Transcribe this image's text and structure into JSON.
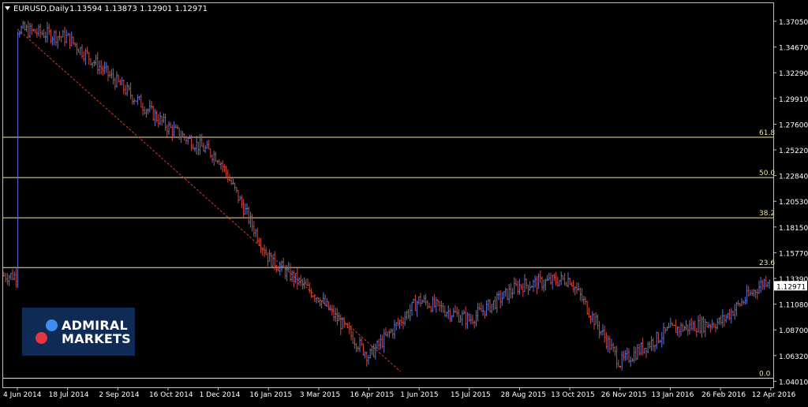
{
  "header": {
    "symbol": "EURUSD,Daily",
    "ohlc": "1.13594 1.13873 1.12901 1.12971"
  },
  "logo": {
    "line1": "ADMIRAL",
    "line2": "MARKETS"
  },
  "colors": {
    "background": "#000000",
    "frame": "#c0c0c0",
    "bull": "#5b78d8",
    "bear": "#d24a3a",
    "fib": "#f2e6a0",
    "trend": "#d23a2a",
    "axis_text": "#ffffff"
  },
  "chart_data": {
    "type": "ohlc",
    "title": "EURUSD,Daily",
    "y_ticks": [
      "1.37050",
      "1.34670",
      "1.32290",
      "1.29910",
      "1.27600",
      "1.25220",
      "1.22840",
      "1.20530",
      "1.18150",
      "1.15770",
      "1.13390",
      "1.11080",
      "1.08700",
      "1.06320",
      "1.04010"
    ],
    "ylim": [
      1.0401,
      1.3824
    ],
    "x_ticks": [
      "4 Jun 2014",
      "18 Jul 2014",
      "2 Sep 2014",
      "16 Oct 2014",
      "1 Dec 2014",
      "16 Jan 2015",
      "3 Mar 2015",
      "16 Apr 2015",
      "1 Jun 2015",
      "15 Jul 2015",
      "28 Aug 2015",
      "13 Oct 2015",
      "26 Nov 2015",
      "13 Jan 2016",
      "26 Feb 2016",
      "12 Apr 2016"
    ],
    "current_price": "1.12971",
    "fibonacci": {
      "levels": [
        {
          "label": "61.8",
          "price": 1.264
        },
        {
          "label": "50.0",
          "price": 1.2276
        },
        {
          "label": "38.2",
          "price": 1.1912
        },
        {
          "label": "23.6",
          "price": 1.1462
        },
        {
          "label": "0.0",
          "price": 1.0462
        }
      ]
    },
    "trendline": {
      "from": {
        "x": "4 Jun 2014",
        "price": 1.362
      },
      "to": {
        "x": "16 Apr 2015",
        "price": 1.05
      }
    },
    "price_path": [
      {
        "x": "4 Jun 2014",
        "price": 1.362
      },
      {
        "x": "18 Jul 2014",
        "price": 1.354
      },
      {
        "x": "2 Sep 2014",
        "price": 1.313
      },
      {
        "x": "16 Oct 2014",
        "price": 1.273
      },
      {
        "x": "1 Dec 2014",
        "price": 1.246
      },
      {
        "x": "16 Jan 2015",
        "price": 1.155
      },
      {
        "x": "3 Mar 2015",
        "price": 1.119
      },
      {
        "x": "16 Apr 2015",
        "price": 1.066
      },
      {
        "x": "1 Jun 2015",
        "price": 1.117
      },
      {
        "x": "15 Jul 2015",
        "price": 1.099
      },
      {
        "x": "28 Aug 2015",
        "price": 1.13
      },
      {
        "x": "13 Oct 2015",
        "price": 1.136
      },
      {
        "x": "26 Nov 2015",
        "price": 1.06
      },
      {
        "x": "13 Jan 2016",
        "price": 1.09
      },
      {
        "x": "26 Feb 2016",
        "price": 1.097
      },
      {
        "x": "12 Apr 2016",
        "price": 1.139
      }
    ]
  }
}
